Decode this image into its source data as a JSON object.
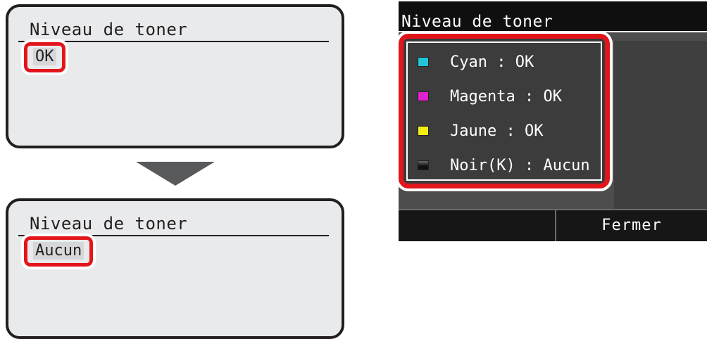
{
  "screens": {
    "mono_before": {
      "title": "Niveau de toner",
      "value": "OK"
    },
    "mono_after": {
      "title": "Niveau de toner",
      "value": "Aucun"
    },
    "color": {
      "title": "Niveau de toner",
      "items": [
        {
          "label": "Cyan : OK",
          "color": "#22c4d6"
        },
        {
          "label": "Magenta : OK",
          "color": "#e021d0"
        },
        {
          "label": "Jaune : OK",
          "color": "#f2ee14"
        },
        {
          "label": "Noir(K) : Aucun",
          "color": "#1a1a1a"
        }
      ],
      "close_label": "Fermer"
    }
  },
  "colors": {
    "highlight": "#e3151b",
    "lcd_background": "#e9eaeb",
    "panel_background": "#4d4d4d"
  },
  "icons": {
    "transition": "down-arrow-icon"
  }
}
